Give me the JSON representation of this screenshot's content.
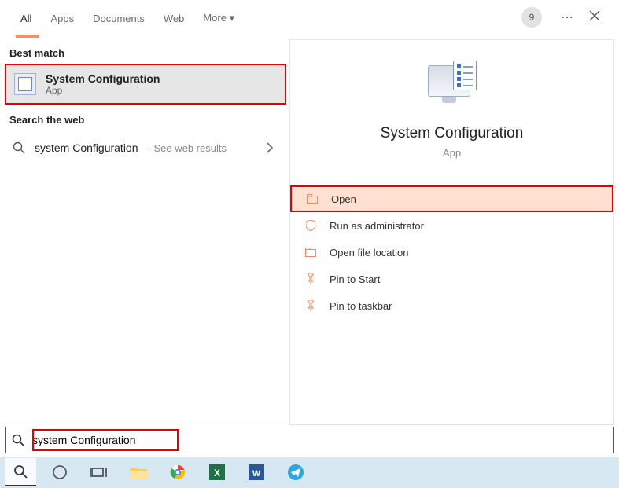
{
  "tabs": {
    "all": "All",
    "apps": "Apps",
    "documents": "Documents",
    "web": "Web",
    "more": "More"
  },
  "badge": "9",
  "sections": {
    "best_match": "Best match",
    "search_web": "Search the web"
  },
  "best": {
    "title": "System Configuration",
    "sub": "App"
  },
  "web_result": {
    "query": "system Configuration",
    "hint": "See web results"
  },
  "preview": {
    "title": "System Configuration",
    "sub": "App"
  },
  "actions": {
    "open": "Open",
    "run_admin": "Run as administrator",
    "open_loc": "Open file location",
    "pin_start": "Pin to Start",
    "pin_taskbar": "Pin to taskbar"
  },
  "search": {
    "value": "system Configuration"
  }
}
